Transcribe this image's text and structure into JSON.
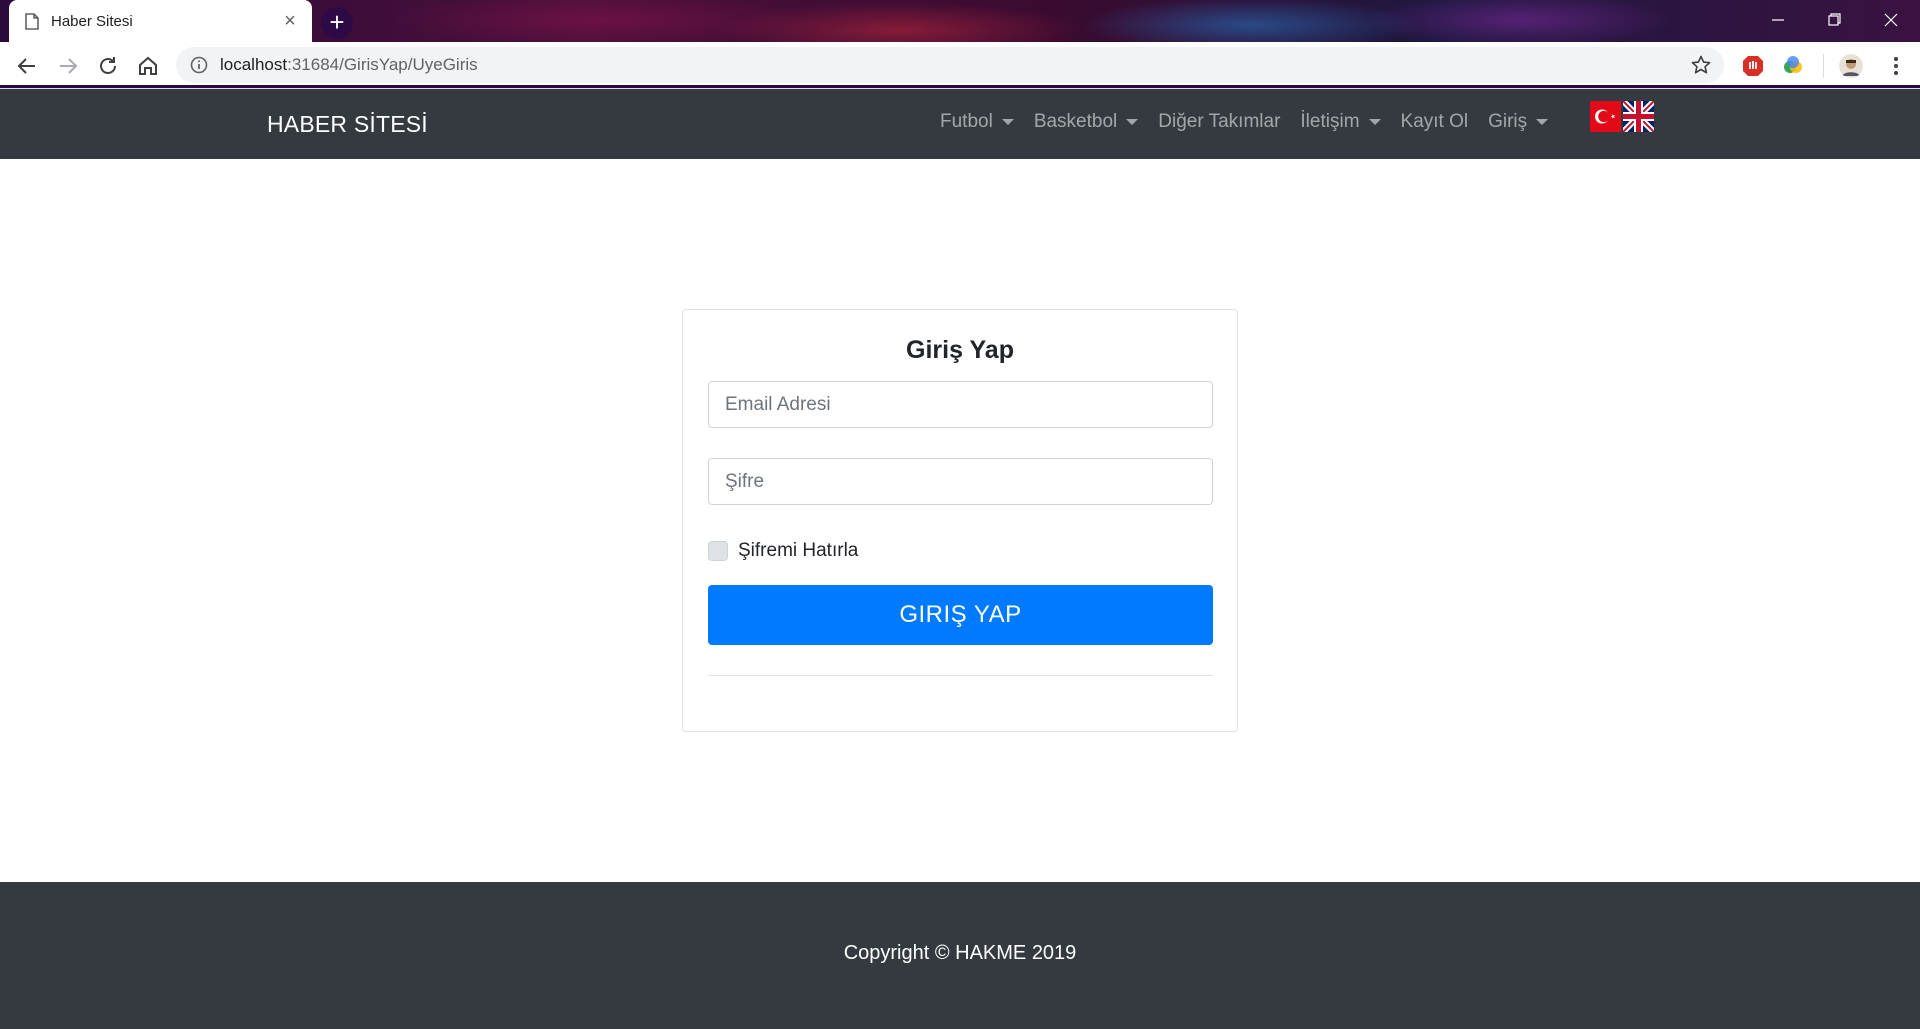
{
  "browser": {
    "tab_title": "Haber Sitesi",
    "tab_close": "×",
    "new_tab": "+",
    "url_host": "localhost",
    "url_rest": ":31684/GirisYap/UyeGiris"
  },
  "navbar": {
    "brand": "HABER SİTESİ",
    "links": {
      "futbol": "Futbol",
      "basketbol": "Basketbol",
      "diger": "Diğer Takımlar",
      "iletisim": "İletişim",
      "kayit": "Kayıt Ol",
      "giris": "Giriş"
    }
  },
  "login": {
    "title": "Giriş Yap",
    "email_placeholder": "Email Adresi",
    "password_placeholder": "Şifre",
    "remember_label": "Şifremi Hatırla",
    "button_label": "GIRIŞ YAP"
  },
  "footer": {
    "text": "Copyright © HAKME 2019"
  },
  "colors": {
    "navbar_bg": "#343a40",
    "primary": "#007bff",
    "footer_bg": "#343a40"
  }
}
